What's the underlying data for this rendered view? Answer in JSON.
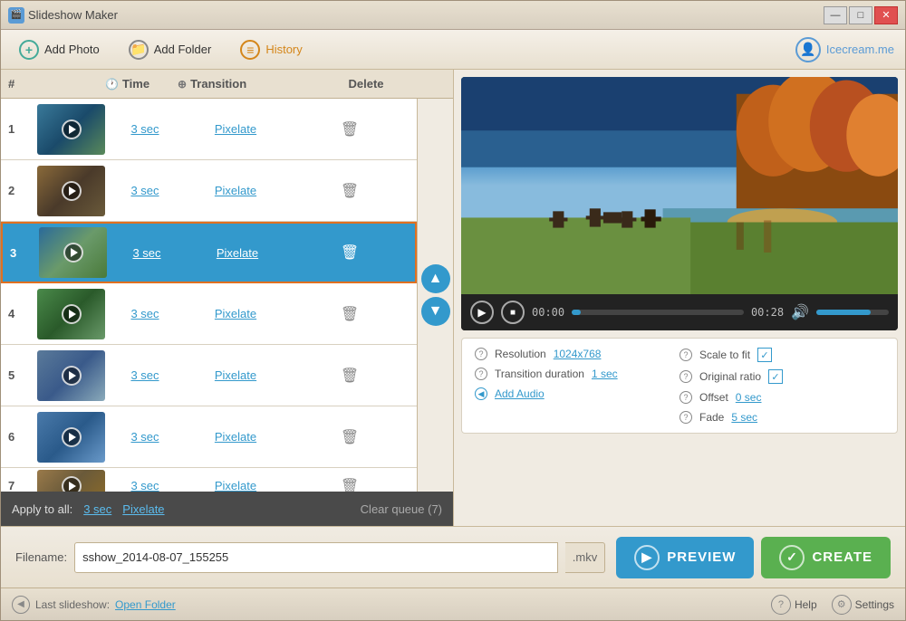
{
  "window": {
    "title": "Slideshow Maker",
    "icon": "🎬"
  },
  "titlebar": {
    "minimize": "—",
    "restore": "□",
    "close": "✕"
  },
  "toolbar": {
    "add_photo": "Add Photo",
    "add_folder": "Add Folder",
    "history": "History",
    "logo": "Icecream.me"
  },
  "table": {
    "col_num": "#",
    "col_time": "Time",
    "col_transition": "Transition",
    "col_delete": "Delete"
  },
  "slides": [
    {
      "num": 1,
      "time": "3 sec",
      "transition": "Pixelate",
      "thumb_class": "thumb-1"
    },
    {
      "num": 2,
      "time": "3 sec",
      "transition": "Pixelate",
      "thumb_class": "thumb-2"
    },
    {
      "num": 3,
      "time": "3 sec",
      "transition": "Pixelate",
      "thumb_class": "thumb-3",
      "selected": true
    },
    {
      "num": 4,
      "time": "3 sec",
      "transition": "Pixelate",
      "thumb_class": "thumb-4"
    },
    {
      "num": 5,
      "time": "3 sec",
      "transition": "Pixelate",
      "thumb_class": "thumb-5"
    },
    {
      "num": 6,
      "time": "3 sec",
      "transition": "Pixelate",
      "thumb_class": "thumb-6"
    },
    {
      "num": 7,
      "time": "3 sec",
      "transition": "Pixelate",
      "thumb_class": "thumb-7"
    }
  ],
  "apply_bar": {
    "label": "Apply to all:",
    "time": "3 sec",
    "transition": "Pixelate",
    "clear": "Clear queue (7)"
  },
  "video": {
    "time_current": "00:00",
    "time_total": "00:28"
  },
  "settings": {
    "resolution_label": "Resolution",
    "resolution_value": "1024x768",
    "transition_duration_label": "Transition duration",
    "transition_duration_value": "1 sec",
    "add_audio_label": "Add Audio",
    "scale_to_fit_label": "Scale to fit",
    "scale_to_fit_checked": "✓",
    "original_ratio_label": "Original ratio",
    "original_ratio_checked": "✓",
    "offset_label": "Offset",
    "offset_value": "0 sec",
    "fade_label": "Fade",
    "fade_value": "5 sec"
  },
  "filename": {
    "label": "Filename:",
    "value": "sshow_2014-08-07_155255",
    "extension": ".mkv"
  },
  "buttons": {
    "preview": "PREVIEW",
    "create": "CREATE"
  },
  "footer": {
    "last_slideshow": "Last slideshow:",
    "open_folder": "Open Folder",
    "help": "Help",
    "settings": "Settings"
  }
}
